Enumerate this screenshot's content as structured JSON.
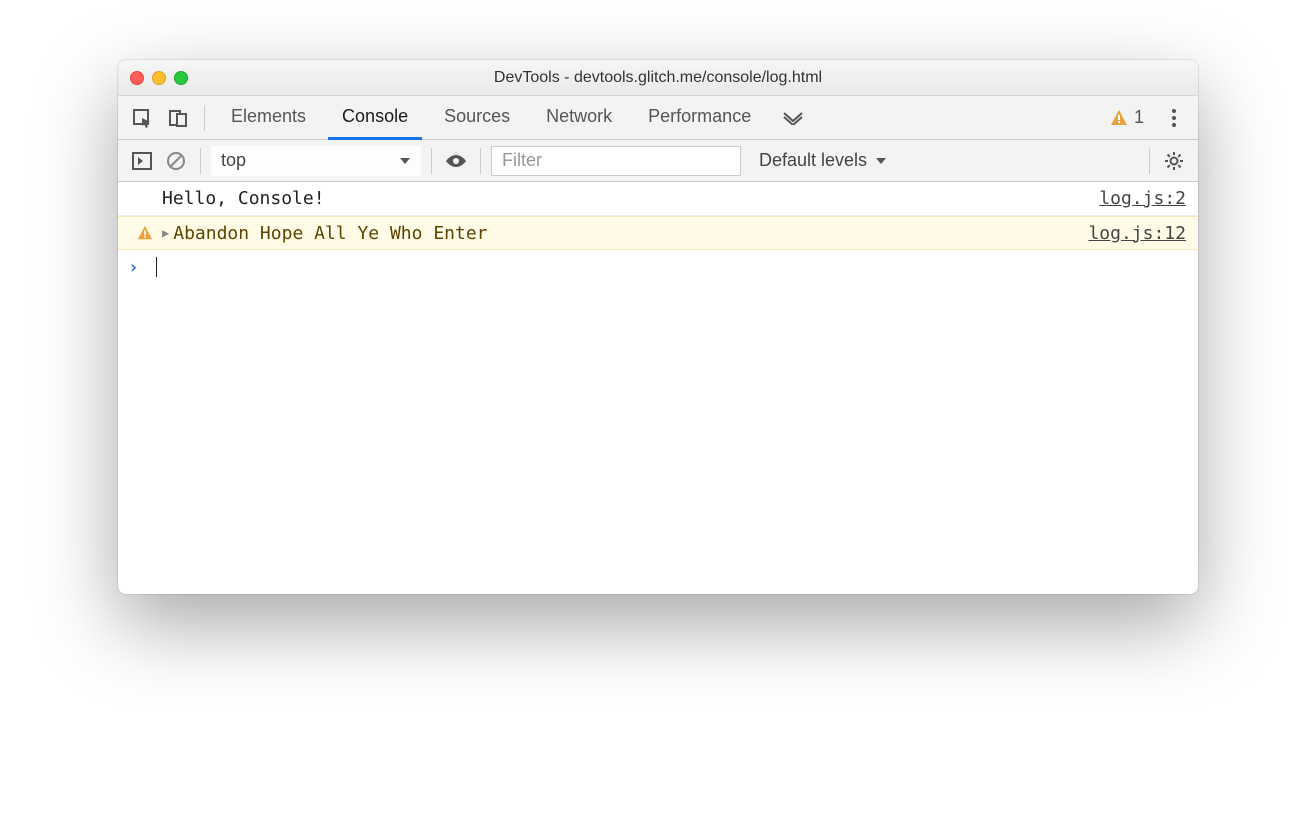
{
  "window": {
    "title": "DevTools - devtools.glitch.me/console/log.html"
  },
  "tabs": {
    "elements": "Elements",
    "console": "Console",
    "sources": "Sources",
    "network": "Network",
    "performance": "Performance"
  },
  "badge": {
    "warning_count": "1"
  },
  "toolbar": {
    "context": "top",
    "filter_placeholder": "Filter",
    "levels": "Default levels"
  },
  "log": [
    {
      "type": "log",
      "message": "Hello, Console!",
      "source": "log.js:2"
    },
    {
      "type": "warn",
      "message": "Abandon Hope All Ye Who Enter",
      "source": "log.js:12"
    }
  ]
}
